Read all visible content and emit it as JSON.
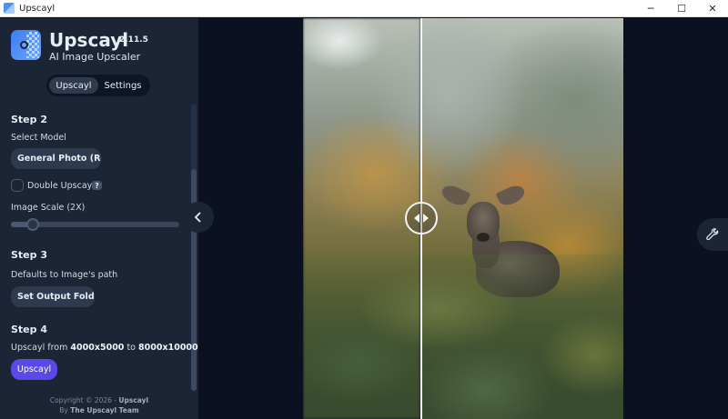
{
  "window": {
    "title": "Upscayl",
    "controls": {
      "minimize": "─",
      "maximize": "☐",
      "close": "✕"
    }
  },
  "brand": {
    "name": "Upscayl",
    "version": "2.11.5",
    "subtitle": "AI Image Upscaler"
  },
  "tabs": [
    {
      "label": "Upscayl",
      "active": true
    },
    {
      "label": "Settings",
      "active": false
    }
  ],
  "step2": {
    "title": "Step 2",
    "select_model_label": "Select Model",
    "model_value": "General Photo (Re...",
    "double_upscayl_label": "Double Upscayl",
    "double_upscayl_checked": false,
    "help_badge": "?",
    "image_scale_label": "Image Scale (2X)",
    "image_scale_fraction": 0.1
  },
  "step3": {
    "title": "Step 3",
    "defaults_label": "Defaults to Image's path",
    "output_button": "Set Output Folder"
  },
  "step4": {
    "title": "Step 4",
    "upscayl_from": "Upscayl from",
    "from_size": "4000x5000",
    "to": "to",
    "to_size": "8000x10000",
    "button": "Upscayl"
  },
  "footer": {
    "copyright": "Copyright © 2026 -",
    "copyright_name": "Upscayl",
    "by": "By",
    "team": "The Upscayl Team"
  },
  "colors": {
    "sidebar_bg": "#1c2536",
    "main_bg": "#0b1120",
    "accent": "#5b48e8"
  },
  "icons": {
    "collapse": "chevron-left-icon",
    "compare_handle": "left-right-arrows-icon",
    "settings": "wrench-icon"
  }
}
